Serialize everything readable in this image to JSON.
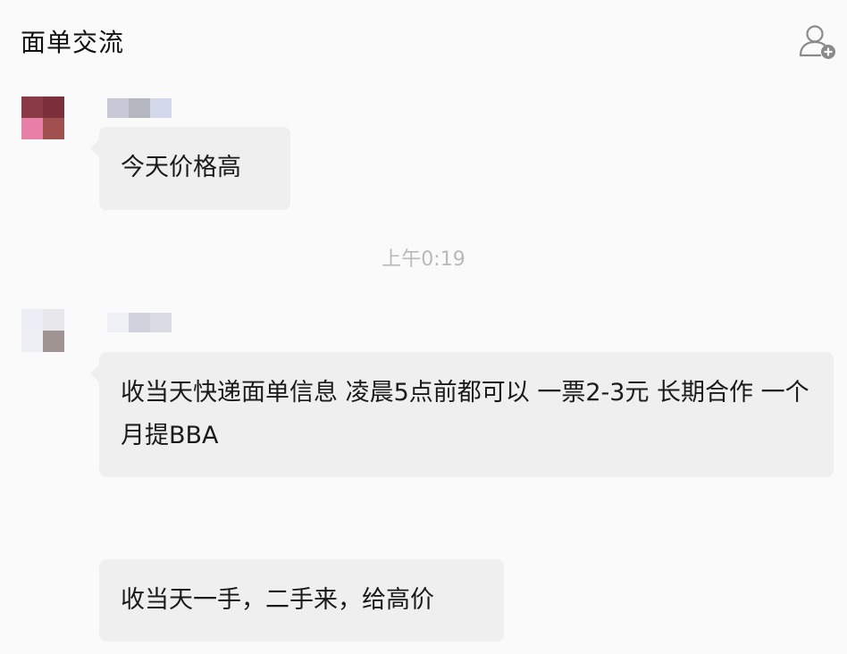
{
  "header": {
    "title": "面单交流",
    "add_member_icon": "add-member-icon"
  },
  "messages": [
    {
      "text": "今天价格高"
    },
    {
      "text": "收当天快递面单信息 凌晨5点前都可以 一票2-3元 长期合作 一个月提BBA"
    },
    {
      "text": "收当天一手，二手来，给高价"
    }
  ],
  "timestamp": "上午0:19",
  "colors": {
    "background": "#fafafa",
    "bubble": "#efefef",
    "timestamp": "#b9b9b9"
  }
}
